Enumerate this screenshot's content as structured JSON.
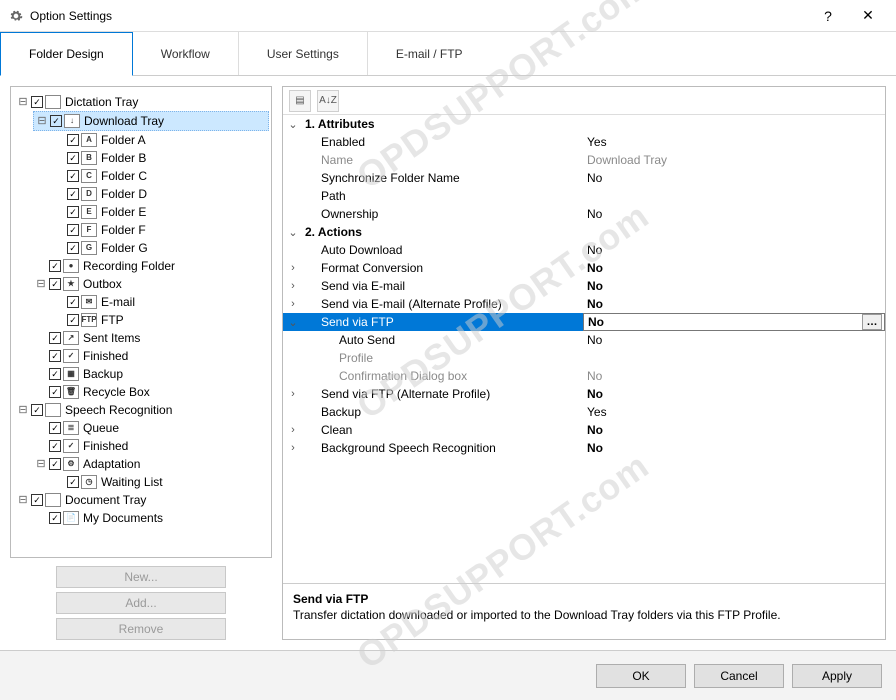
{
  "window": {
    "title": "Option Settings",
    "help": "?",
    "close": "✕"
  },
  "tabs": [
    {
      "label": "Folder Design",
      "active": true
    },
    {
      "label": "Workflow",
      "active": false
    },
    {
      "label": "User Settings",
      "active": false
    },
    {
      "label": "E-mail / FTP",
      "active": false
    }
  ],
  "tree": [
    {
      "label": "Dictation Tray",
      "icon": "",
      "expand": "⊟",
      "children": [
        {
          "label": "Download Tray",
          "icon": "↓",
          "expand": "⊟",
          "selected": true,
          "children": [
            {
              "label": "Folder A",
              "icon": "A",
              "expand": ""
            },
            {
              "label": "Folder B",
              "icon": "B",
              "expand": ""
            },
            {
              "label": "Folder C",
              "icon": "C",
              "expand": ""
            },
            {
              "label": "Folder D",
              "icon": "D",
              "expand": ""
            },
            {
              "label": "Folder E",
              "icon": "E",
              "expand": ""
            },
            {
              "label": "Folder F",
              "icon": "F",
              "expand": ""
            },
            {
              "label": "Folder G",
              "icon": "G",
              "expand": ""
            }
          ]
        },
        {
          "label": "Recording Folder",
          "icon": "●",
          "expand": ""
        },
        {
          "label": "Outbox",
          "icon": "★",
          "expand": "⊟",
          "children": [
            {
              "label": "E-mail",
              "icon": "✉",
              "expand": ""
            },
            {
              "label": "FTP",
              "icon": "FTP",
              "expand": ""
            }
          ]
        },
        {
          "label": "Sent Items",
          "icon": "↗",
          "expand": ""
        },
        {
          "label": "Finished",
          "icon": "✓",
          "expand": ""
        },
        {
          "label": "Backup",
          "icon": "▦",
          "expand": ""
        },
        {
          "label": "Recycle Box",
          "icon": "🗑",
          "expand": ""
        }
      ]
    },
    {
      "label": "Speech Recognition",
      "icon": "",
      "expand": "⊟",
      "children": [
        {
          "label": "Queue",
          "icon": "≣",
          "expand": ""
        },
        {
          "label": "Finished",
          "icon": "✓",
          "expand": ""
        },
        {
          "label": "Adaptation",
          "icon": "⚙",
          "expand": "⊟",
          "children": [
            {
              "label": "Waiting List",
              "icon": "◷",
              "expand": ""
            }
          ]
        }
      ]
    },
    {
      "label": "Document Tray",
      "icon": "",
      "expand": "⊟",
      "children": [
        {
          "label": "My Documents",
          "icon": "📄",
          "expand": ""
        }
      ]
    }
  ],
  "left_buttons": {
    "new": "New...",
    "add": "Add...",
    "remove": "Remove"
  },
  "prop_toolbar": {
    "cat": "▤",
    "sort": "A↓Z"
  },
  "properties": [
    {
      "type": "cat",
      "exp": "⌄",
      "name": "1. Attributes"
    },
    {
      "type": "row",
      "exp": "",
      "name": "Enabled",
      "value": "Yes",
      "indent": 1
    },
    {
      "type": "row",
      "exp": "",
      "name": "Name",
      "value": "Download Tray",
      "indent": 1,
      "dim": true
    },
    {
      "type": "row",
      "exp": "",
      "name": "Synchronize Folder Name",
      "value": "No",
      "indent": 1
    },
    {
      "type": "row",
      "exp": "",
      "name": "Path",
      "value": "",
      "indent": 1
    },
    {
      "type": "row",
      "exp": "",
      "name": "Ownership",
      "value": "No",
      "indent": 1
    },
    {
      "type": "cat",
      "exp": "⌄",
      "name": "2. Actions"
    },
    {
      "type": "row",
      "exp": "",
      "name": "Auto Download",
      "value": "No",
      "indent": 1
    },
    {
      "type": "row",
      "exp": "›",
      "name": "Format Conversion",
      "value": "No",
      "indent": 1,
      "boldv": true
    },
    {
      "type": "row",
      "exp": "›",
      "name": "Send via E-mail",
      "value": "No",
      "indent": 1,
      "boldv": true
    },
    {
      "type": "row",
      "exp": "›",
      "name": "Send via E-mail (Alternate Profile)",
      "value": "No",
      "indent": 1,
      "boldv": true
    },
    {
      "type": "row",
      "exp": "⌄",
      "name": "Send via FTP",
      "value": "No",
      "indent": 1,
      "boldv": true,
      "selected": true,
      "ellipsis": true
    },
    {
      "type": "row",
      "exp": "",
      "name": "Auto Send",
      "value": "No",
      "indent": 2
    },
    {
      "type": "row",
      "exp": "",
      "name": "Profile",
      "value": "",
      "indent": 2,
      "dim": true
    },
    {
      "type": "row",
      "exp": "",
      "name": "Confirmation Dialog box",
      "value": "No",
      "indent": 2,
      "dim": true
    },
    {
      "type": "row",
      "exp": "›",
      "name": "Send via FTP (Alternate Profile)",
      "value": "No",
      "indent": 1,
      "boldv": true
    },
    {
      "type": "row",
      "exp": "",
      "name": "Backup",
      "value": "Yes",
      "indent": 1
    },
    {
      "type": "row",
      "exp": "›",
      "name": "Clean",
      "value": "No",
      "indent": 1,
      "boldv": true
    },
    {
      "type": "row",
      "exp": "›",
      "name": "Background Speech Recognition",
      "value": "No",
      "indent": 1,
      "boldv": true
    }
  ],
  "description": {
    "title": "Send via FTP",
    "body": "Transfer dictation downloaded or imported to the Download Tray folders via this FTP Profile."
  },
  "footer": {
    "ok": "OK",
    "cancel": "Cancel",
    "apply": "Apply"
  },
  "watermark": "OPDSUPPORT.com"
}
